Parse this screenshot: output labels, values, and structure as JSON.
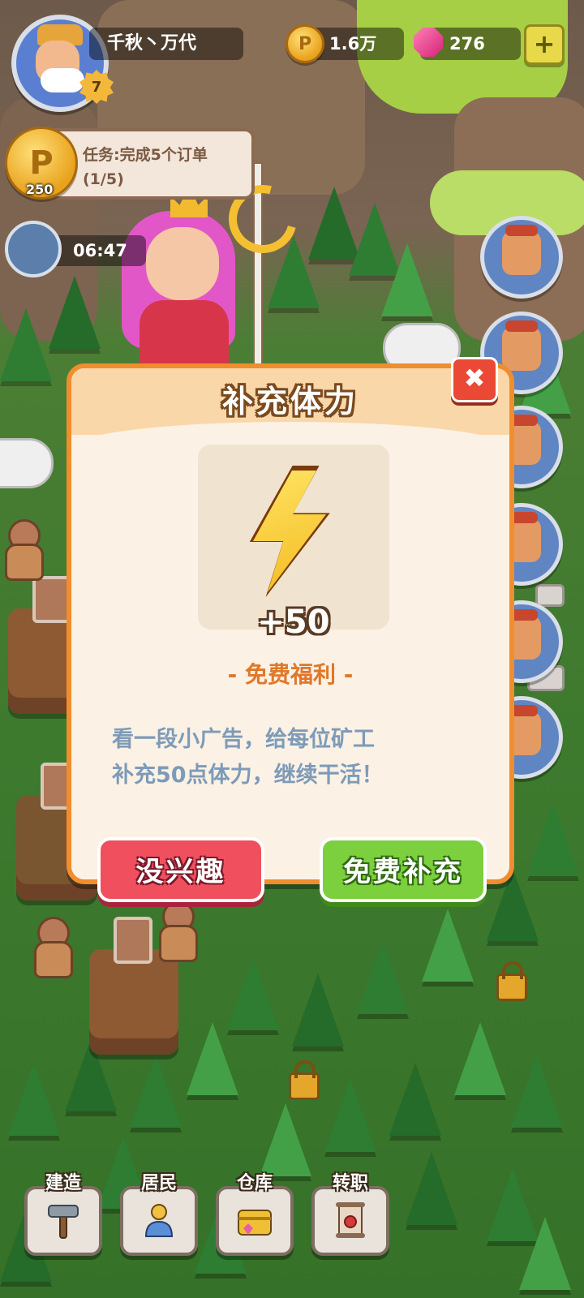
{
  "player": {
    "name": "千秋丶万代",
    "level": "7"
  },
  "resources": {
    "coins": "1.6万",
    "gems": "276",
    "add_label": "+"
  },
  "task": {
    "label": "任务:完成5个订单",
    "progress": "(1/5)",
    "reward": "250"
  },
  "timer": {
    "value": "06:47"
  },
  "dialog": {
    "title": "补充体力",
    "close_label": "✖",
    "reward_amount": "+50",
    "subtitle": "- 免费福利 -",
    "description_line1": "看一段小广告，给每位矿工",
    "description_line2": "补充50点体力，继续干活！",
    "decline_label": "没兴趣",
    "accept_label": "免费补充"
  },
  "nav": [
    {
      "label": "建造",
      "icon": "hammer-icon"
    },
    {
      "label": "居民",
      "icon": "resident-icon"
    },
    {
      "label": "仓库",
      "icon": "chest-icon"
    },
    {
      "label": "转职",
      "icon": "scroll-icon"
    }
  ],
  "colors": {
    "dialog_border": "#f08d2e",
    "decline": "#f0505e",
    "accept": "#7ccf3d",
    "subtitle": "#e0782a",
    "description": "#7d9bb8"
  }
}
